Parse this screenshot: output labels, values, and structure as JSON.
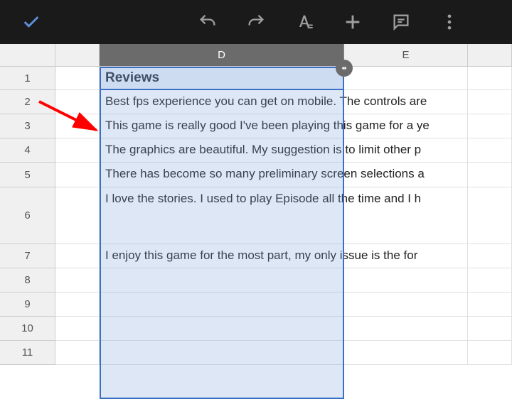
{
  "toolbar": {
    "confirm": "check-icon",
    "undo": "undo-icon",
    "redo": "redo-icon",
    "format": "format-text-icon",
    "insert": "plus-icon",
    "comment": "comment-icon",
    "more": "more-vert-icon"
  },
  "columns": {
    "d": "D",
    "e": "E"
  },
  "rows": {
    "labels": [
      "1",
      "2",
      "3",
      "4",
      "5",
      "6",
      "7",
      "8",
      "9",
      "10",
      "11"
    ],
    "data": [
      {
        "d": "Reviews"
      },
      {
        "d": "Best fps experience you can get on mobile. The controls are"
      },
      {
        "d": "This game is really good I've been playing this game for a ye"
      },
      {
        "d": "The graphics are beautiful. My suggestion is to limit other p"
      },
      {
        "d": "There has become so many preliminary screen selections a"
      },
      {
        "d": "I love the stories. I used to play Episode all the time and I h"
      },
      {
        "d": "I enjoy this game for the most part, my only issue is the for"
      },
      {
        "d": ""
      },
      {
        "d": ""
      },
      {
        "d": ""
      },
      {
        "d": ""
      }
    ]
  },
  "selection": {
    "column": "D",
    "active_row": 1
  },
  "annotation": {
    "type": "arrow",
    "color": "#ff0000"
  }
}
